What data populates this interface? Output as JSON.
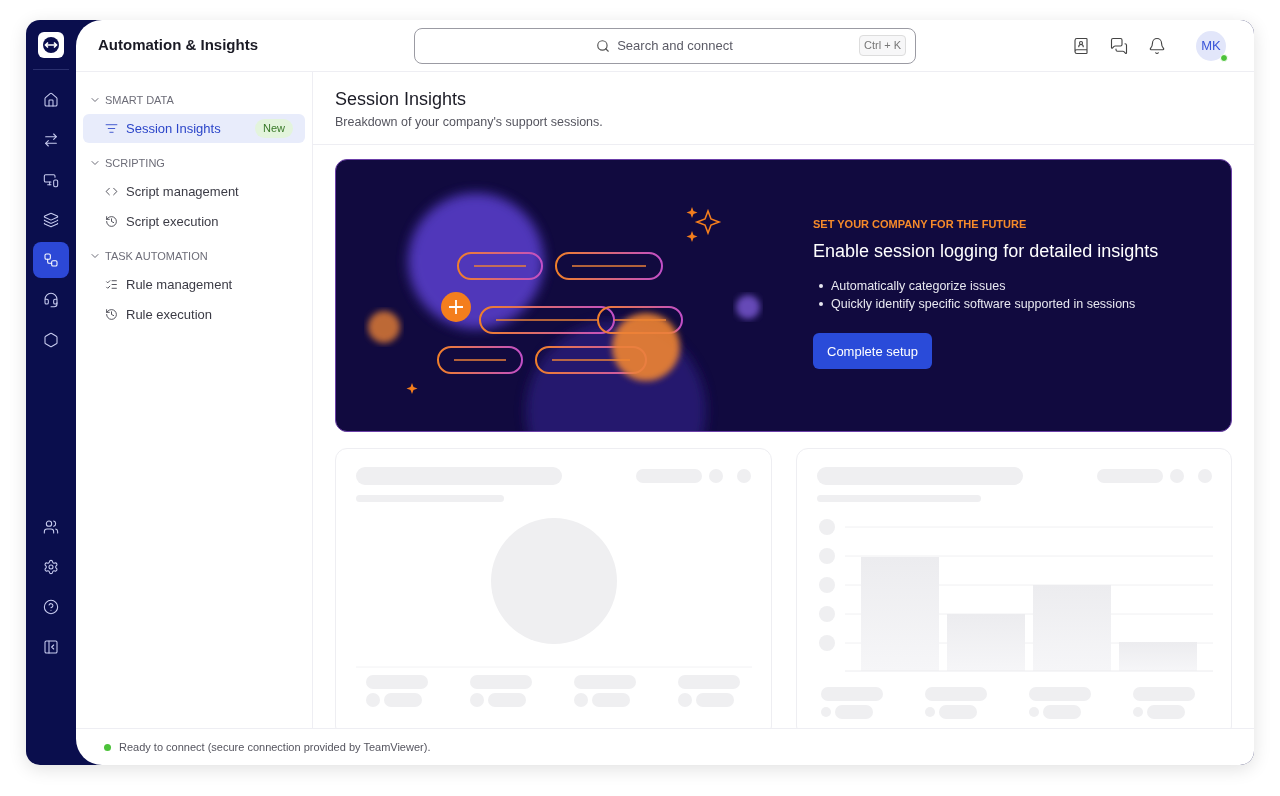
{
  "app": {
    "title": "Automation & Insights"
  },
  "rail": {
    "top": [
      {
        "kind": "home",
        "selected": false
      },
      {
        "kind": "transfer",
        "selected": false
      },
      {
        "kind": "remote",
        "selected": false
      },
      {
        "kind": "screens",
        "selected": false
      },
      {
        "kind": "automation",
        "selected": true
      },
      {
        "kind": "headset",
        "selected": false
      },
      {
        "kind": "hexgear",
        "selected": false
      }
    ],
    "bottom": [
      {
        "kind": "people",
        "selected": false
      },
      {
        "kind": "settings",
        "selected": false
      },
      {
        "kind": "help",
        "selected": false
      },
      {
        "kind": "exit",
        "selected": false
      }
    ]
  },
  "search": {
    "placeholder": "Search and connect",
    "shortcut": "Ctrl + K"
  },
  "avatar": {
    "initials": "MK",
    "online": true
  },
  "nav": [
    {
      "heading": "SMART DATA",
      "expanded": true,
      "items": [
        {
          "label": "Session Insights",
          "selected": true,
          "badge": "New"
        }
      ]
    },
    {
      "heading": "SCRIPTING",
      "expanded": true,
      "items": [
        {
          "label": "Script management",
          "selected": false
        },
        {
          "label": "Script execution",
          "selected": false
        }
      ]
    },
    {
      "heading": "TASK AUTOMATION",
      "expanded": true,
      "items": [
        {
          "label": "Rule management",
          "selected": false
        },
        {
          "label": "Rule execution",
          "selected": false
        }
      ]
    }
  ],
  "page": {
    "title": "Session Insights",
    "subtitle": "Breakdown of your company's support sessions."
  },
  "banner": {
    "eyebrow": "SET YOUR COMPANY FOR THE FUTURE",
    "title": "Enable session logging for detailed insights",
    "bullets": [
      "Automatically categorize issues",
      "Quickly identify specific software supported in sessions"
    ],
    "button": "Complete setup"
  },
  "status": {
    "text": "Ready to connect (secure connection provided by TeamViewer).",
    "connected": true
  }
}
